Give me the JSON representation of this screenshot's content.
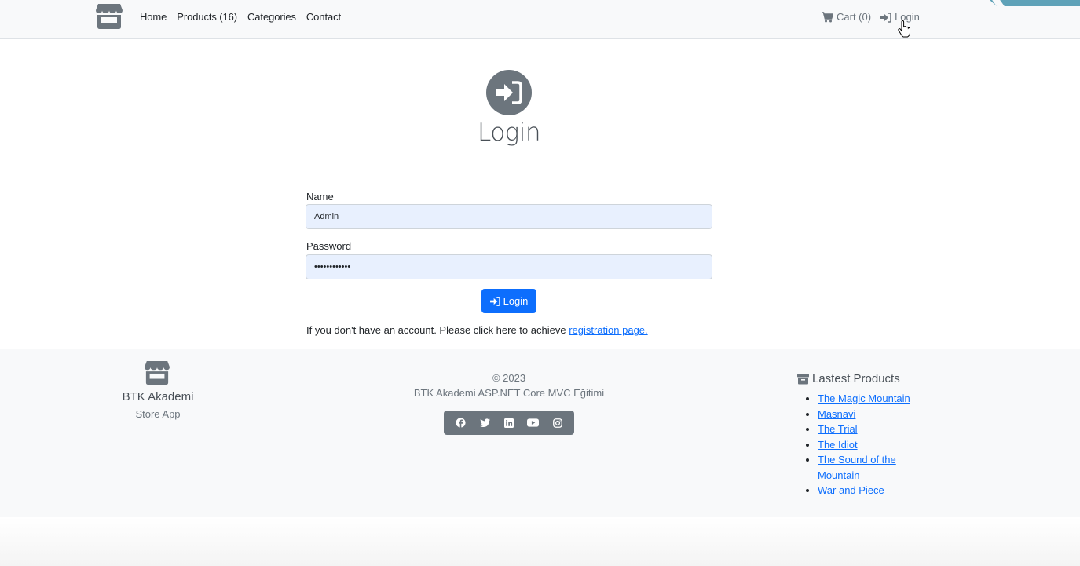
{
  "nav": {
    "links": [
      "Home",
      "Products (16)",
      "Categories",
      "Contact"
    ],
    "cart": "Cart (0)",
    "login": "Login"
  },
  "page": {
    "title": "Login"
  },
  "form": {
    "name_label": "Name",
    "name_value": "Admin",
    "password_label": "Password",
    "password_value": "Admin123456!",
    "submit_label": "Login",
    "register_prefix": "If you don't have an account. Please click here to achieve ",
    "register_link": "registration page."
  },
  "footer": {
    "brand_name": "BTK Akademi",
    "brand_sub": "Store App",
    "copyright": "© 2023",
    "school": "BTK Akademi ASP.NET Core MVC Eğitimi",
    "social": [
      "facebook-icon",
      "twitter-icon",
      "linkedin-icon",
      "youtube-icon",
      "instagram-icon"
    ],
    "latest_heading": "Lastest Products",
    "latest_products": [
      "The Magic Mountain",
      "Masnavi",
      "The Trial",
      "The Idiot",
      "The Sound of the Mountain",
      "War and Piece"
    ]
  },
  "colors": {
    "primary": "#0d6efd",
    "secondary": "#6c757d",
    "light": "#f8f9fa",
    "input_bg": "#e8f0fe"
  }
}
